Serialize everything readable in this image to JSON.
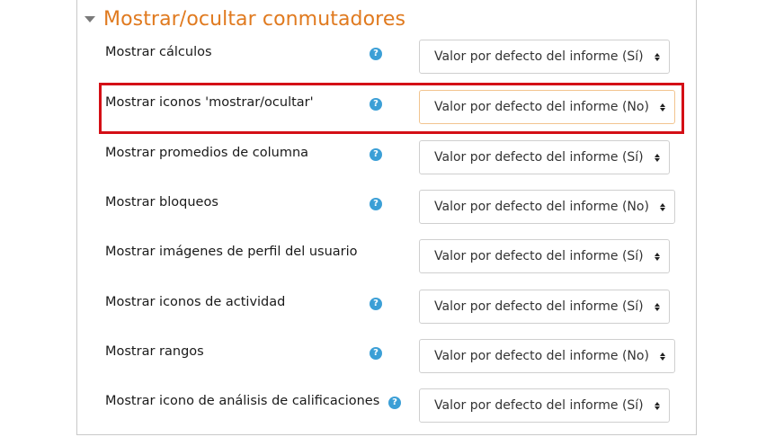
{
  "section": {
    "title": "Mostrar/ocultar conmutadores",
    "caret_icon": "triangle-down-icon"
  },
  "rows": [
    {
      "label": "Mostrar cálculos",
      "has_help": true,
      "value": "Valor por defecto del informe (Sí)"
    },
    {
      "label": "Mostrar iconos 'mostrar/ocultar'",
      "has_help": true,
      "value": "Valor por defecto del informe (No)"
    },
    {
      "label": "Mostrar promedios de columna",
      "has_help": true,
      "value": "Valor por defecto del informe (Sí)"
    },
    {
      "label": "Mostrar bloqueos",
      "has_help": true,
      "value": "Valor por defecto del informe (No)"
    },
    {
      "label": "Mostrar imágenes de perfil del usuario",
      "has_help": false,
      "value": "Valor por defecto del informe (Sí)"
    },
    {
      "label": "Mostrar iconos de actividad",
      "has_help": true,
      "value": "Valor por defecto del informe (Sí)"
    },
    {
      "label": "Mostrar rangos",
      "has_help": true,
      "value": "Valor por defecto del informe (No)"
    },
    {
      "label": "Mostrar icono de análisis de calificaciones",
      "has_help": true,
      "value": "Valor por defecto del informe (Sí)"
    }
  ],
  "help_icon_glyph": "?",
  "colors": {
    "section_title": "#e07a1f",
    "help_icon": "#3b9fd6",
    "highlight": "#d40f16"
  }
}
